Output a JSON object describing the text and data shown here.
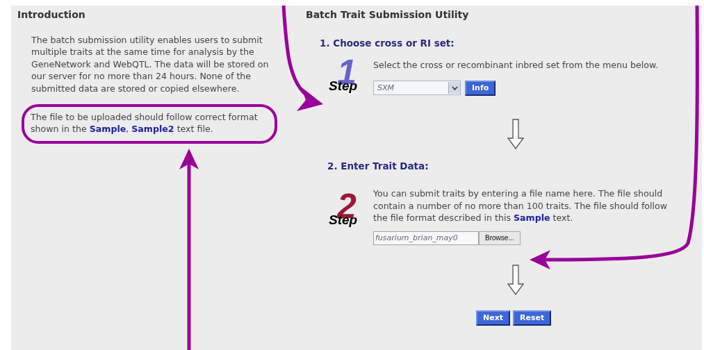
{
  "introduction": {
    "title": "Introduction",
    "paragraphs": [
      {
        "text": "The batch submission utility enables users to submit multiple traits at the same time for analysis by the GeneNetwork and WebQTL. The data will be stored on our server for no more than 24 hours. None of the submitted data are stored or copied elsewhere.",
        "circled": false
      },
      {
        "text": "The file to be uploaded should follow correct format shown in the **Sample**, **Sample2** text file.",
        "circled": true
      }
    ]
  },
  "utility": {
    "title": "Batch Trait Submission Utility",
    "steps": [
      {
        "kind": "select",
        "heading": "1. Choose cross or RI set:",
        "badge_number": "1",
        "badge_word": "Step",
        "color": "#6a62c8",
        "text": "Select the cross or recombinant inbred set from the menu below.",
        "value": "SXM",
        "button": "Info"
      },
      {
        "kind": "file",
        "heading": "2. Enter Trait Data:",
        "badge_number": "2",
        "badge_word": "Step",
        "color": "#9a1838",
        "text": "You can submit traits by entering a file name here. The file should contain a number of no more than 100 traits. The file should follow the file format described in this **Sample** text.",
        "value": "fusarium_brian_may0",
        "button": "Browse..."
      }
    ],
    "buttons": [
      "Next",
      "Reset"
    ]
  },
  "annotations": [
    {
      "kind": "arrow"
    },
    {
      "kind": "arrow"
    },
    {
      "kind": "arrow"
    }
  ]
}
